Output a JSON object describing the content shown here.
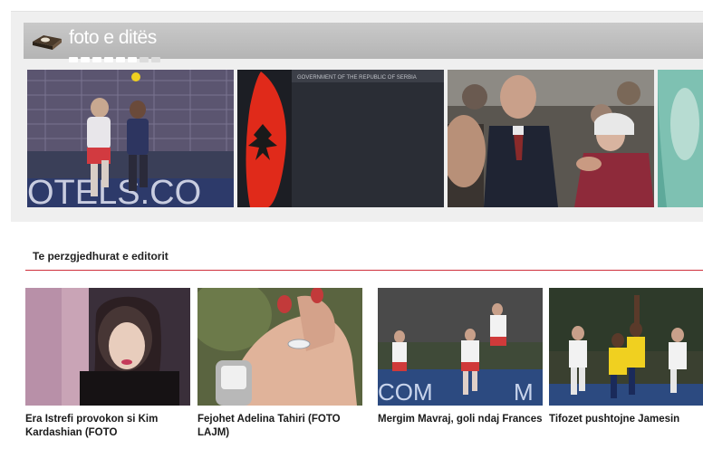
{
  "photo_of_day": {
    "title": "foto e ditës",
    "icon": "camera-icon",
    "photos": [
      {
        "name": "football-match-photo"
      },
      {
        "name": "albanian-flag-photo"
      },
      {
        "name": "crowd-greeting-photo"
      },
      {
        "name": "partial-teal-photo"
      }
    ]
  },
  "editors_picks": {
    "title": "Te perzgjedhurat e editorit",
    "accent_color": "#cf2f3b",
    "items": [
      {
        "caption": "Era Istrefi provokon si Kim Kardashian (FOTO"
      },
      {
        "caption": "Fejohet Adelina Tahiri (FOTO LAJM)"
      },
      {
        "caption": "Mergim Mavraj, goli ndaj Frances"
      },
      {
        "caption": "Tifozet pushtojne Jamesin"
      }
    ]
  }
}
